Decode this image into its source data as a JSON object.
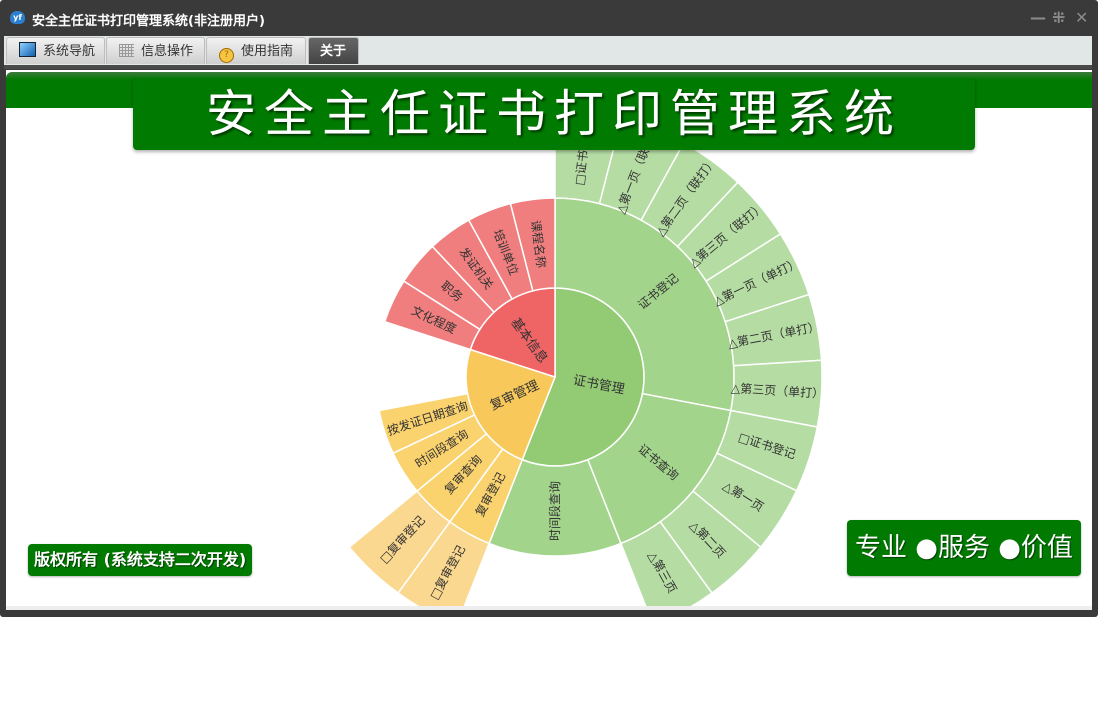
{
  "window": {
    "title": "安全主任证书打印管理系统(非注册用户)",
    "app_icon": "yf-cloud-icon",
    "controls": {
      "minimize": "—",
      "restore": "⁜",
      "close": "✕"
    }
  },
  "tabs": [
    {
      "label": "系统导航",
      "icon": "monitor-icon",
      "active": false
    },
    {
      "label": "信息操作",
      "icon": "grid-icon",
      "active": false
    },
    {
      "label": "使用指南",
      "icon": "help-icon",
      "active": false
    },
    {
      "label": "关于",
      "active": true
    }
  ],
  "banner": {
    "title": "安全主任证书打印管理系统"
  },
  "footer": {
    "copyright": "版权所有 (系统支持二次开发)",
    "slogan": "专业 ●服务 ●价值"
  },
  "colors": {
    "brand_green": "#007a00",
    "green": [
      "#93cb75",
      "#a3d48b",
      "#b5dca3"
    ],
    "red": [
      "#ef6566",
      "#f07e7e",
      "#f07e7e"
    ],
    "orange": [
      "#f8c85a",
      "#fad26e",
      "#fbd88f"
    ]
  },
  "chart_data": {
    "type": "sunburst",
    "start": "top-clockwise",
    "total": 25,
    "nodes": [
      {
        "name": "证书管理",
        "color": "green",
        "value": 14,
        "children": [
          {
            "name": "证书登记",
            "value": 7,
            "children": [
              {
                "name": "□证书登记",
                "value": 1
              },
              {
                "name": "△第一页（联打）",
                "value": 1
              },
              {
                "name": "△第二页（联打）",
                "value": 1
              },
              {
                "name": "△第三页（联打）",
                "value": 1
              },
              {
                "name": "△第一页（单打）",
                "value": 1
              },
              {
                "name": "△第二页（单打）",
                "value": 1
              },
              {
                "name": "△第三页（单打）",
                "value": 1
              }
            ]
          },
          {
            "name": "证书查询",
            "value": 4,
            "children": [
              {
                "name": "□证书登记",
                "value": 1
              },
              {
                "name": "△第一页",
                "value": 1
              },
              {
                "name": "△第二页",
                "value": 1
              },
              {
                "name": "△第三页",
                "value": 1
              }
            ]
          },
          {
            "name": "时间段查询",
            "value": 3
          }
        ]
      },
      {
        "name": "复审管理",
        "color": "orange",
        "value": 6,
        "children": [
          {
            "name": "复审登记",
            "value": 1,
            "children": [
              {
                "name": "□复审登记",
                "value": 1
              }
            ]
          },
          {
            "name": "复审查询",
            "value": 1,
            "children": [
              {
                "name": "□复审登记",
                "value": 1
              }
            ]
          },
          {
            "name": "时间段查询",
            "value": 1
          },
          {
            "name": "按发证日期查询",
            "value": 1
          }
        ]
      },
      {
        "name": "基本信息",
        "color": "red",
        "value": 5,
        "children": [
          {
            "name": "文化程度",
            "value": 1
          },
          {
            "name": "职务",
            "value": 1
          },
          {
            "name": "发证机关",
            "value": 1
          },
          {
            "name": "培训单位",
            "value": 1
          },
          {
            "name": "课程名称",
            "value": 1
          }
        ]
      }
    ]
  }
}
